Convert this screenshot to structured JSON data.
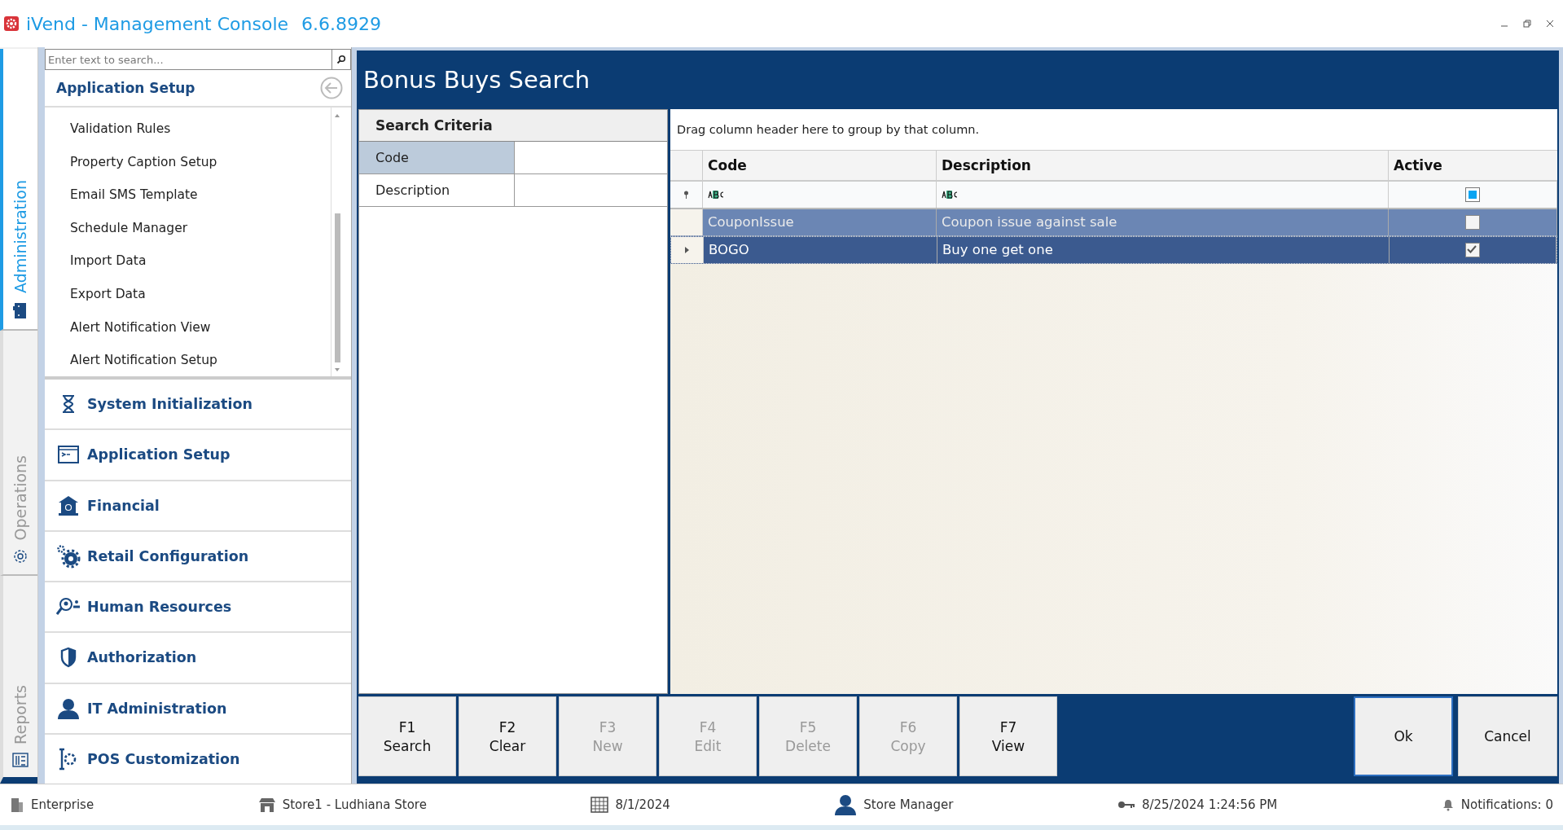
{
  "window": {
    "title": "iVend - Management Console",
    "version": "6.6.8929"
  },
  "side_tabs": [
    {
      "label": "Administration",
      "selected": true
    },
    {
      "label": "Operations",
      "selected": false
    },
    {
      "label": "Reports",
      "selected": false
    }
  ],
  "sidebar": {
    "search": {
      "placeholder": "Enter text to search..."
    },
    "group_title": "Application Setup",
    "items": [
      "Validation Rules",
      "Property Caption Setup",
      "Email SMS Template",
      "Schedule Manager",
      "Import Data",
      "Export Data",
      "Alert Notification View",
      "Alert Notification Setup"
    ],
    "sections": [
      "System Initialization",
      "Application Setup",
      "Financial",
      "Retail Configuration",
      "Human Resources",
      "Authorization",
      "IT Administration",
      "POS Customization"
    ]
  },
  "page_title": "Bonus Buys Search",
  "search_criteria": {
    "title": "Search Criteria",
    "fields": [
      {
        "label": "Code",
        "selected": true
      },
      {
        "label": "Description",
        "selected": false
      }
    ]
  },
  "grid": {
    "group_hint": "Drag column header here to group by that column.",
    "columns": [
      "Code",
      "Description",
      "Active"
    ],
    "active_filter": {
      "indeterminate": true
    },
    "rows": [
      {
        "code": "CouponIssue",
        "description": "Coupon issue against sale",
        "active": false,
        "selected": true,
        "focused": false
      },
      {
        "code": "BOGO",
        "description": "Buy one get one",
        "active": true,
        "selected": true,
        "focused": true
      }
    ]
  },
  "buttons": [
    {
      "key": "F1",
      "label": "Search",
      "disabled": false
    },
    {
      "key": "F2",
      "label": "Clear",
      "disabled": false
    },
    {
      "key": "F3",
      "label": "New",
      "disabled": true
    },
    {
      "key": "F4",
      "label": "Edit",
      "disabled": true
    },
    {
      "key": "F5",
      "label": "Delete",
      "disabled": true
    },
    {
      "key": "F6",
      "label": "Copy",
      "disabled": true
    },
    {
      "key": "F7",
      "label": "View",
      "disabled": false
    }
  ],
  "dialog_buttons": [
    "Ok",
    "Cancel"
  ],
  "status_bar": [
    "Enterprise",
    "Store1 - Ludhiana Store",
    "8/1/2024",
    "Store Manager",
    "8/25/2024 1:24:56 PM",
    "Notifications: 0"
  ]
}
